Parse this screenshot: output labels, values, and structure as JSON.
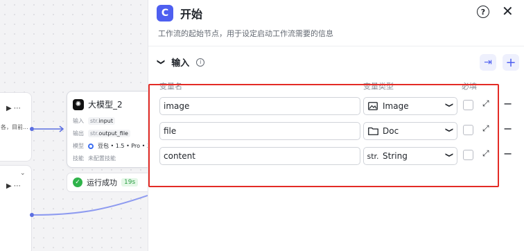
{
  "canvas": {
    "node_a": {
      "controls": "▶ ⋯",
      "snippet": "各，目前..."
    },
    "node_b": {
      "collapse": "⌄",
      "controls": "▶ ⋯"
    },
    "llm_node": {
      "icon": "octopus-icon",
      "title": "大模型_2",
      "rows": [
        {
          "label": "输入",
          "prefix": "str.",
          "value": "input"
        },
        {
          "label": "输出",
          "prefix": "str.",
          "value": "output_file"
        },
        {
          "label": "模型",
          "value": "豆包 • 1.5 • Pro • 3"
        },
        {
          "label": "技能",
          "value": "未配置技能"
        }
      ]
    },
    "run_status": {
      "text": "运行成功",
      "time": "19s",
      "color": "#2fb34a"
    }
  },
  "panel": {
    "badge": "C",
    "title": "开始",
    "help": "?",
    "close": "✕",
    "description": "工作流的起始节点，用于设定启动工作流需要的信息",
    "section": {
      "title": "输入",
      "info": "i",
      "import_icon": "⇥",
      "add_icon": "+",
      "columns": {
        "name": "变量名",
        "type": "变量类型",
        "required": "必填"
      },
      "variables": [
        {
          "name": "image",
          "type": "Image",
          "type_icon": "image-icon"
        },
        {
          "name": "file",
          "type": "Doc",
          "type_icon": "folder-icon"
        },
        {
          "name": "content",
          "type": "String",
          "type_icon": "str-icon",
          "type_prefix": "str."
        }
      ]
    },
    "accent": "#4e5ff0",
    "highlight_color": "#e32b25"
  }
}
